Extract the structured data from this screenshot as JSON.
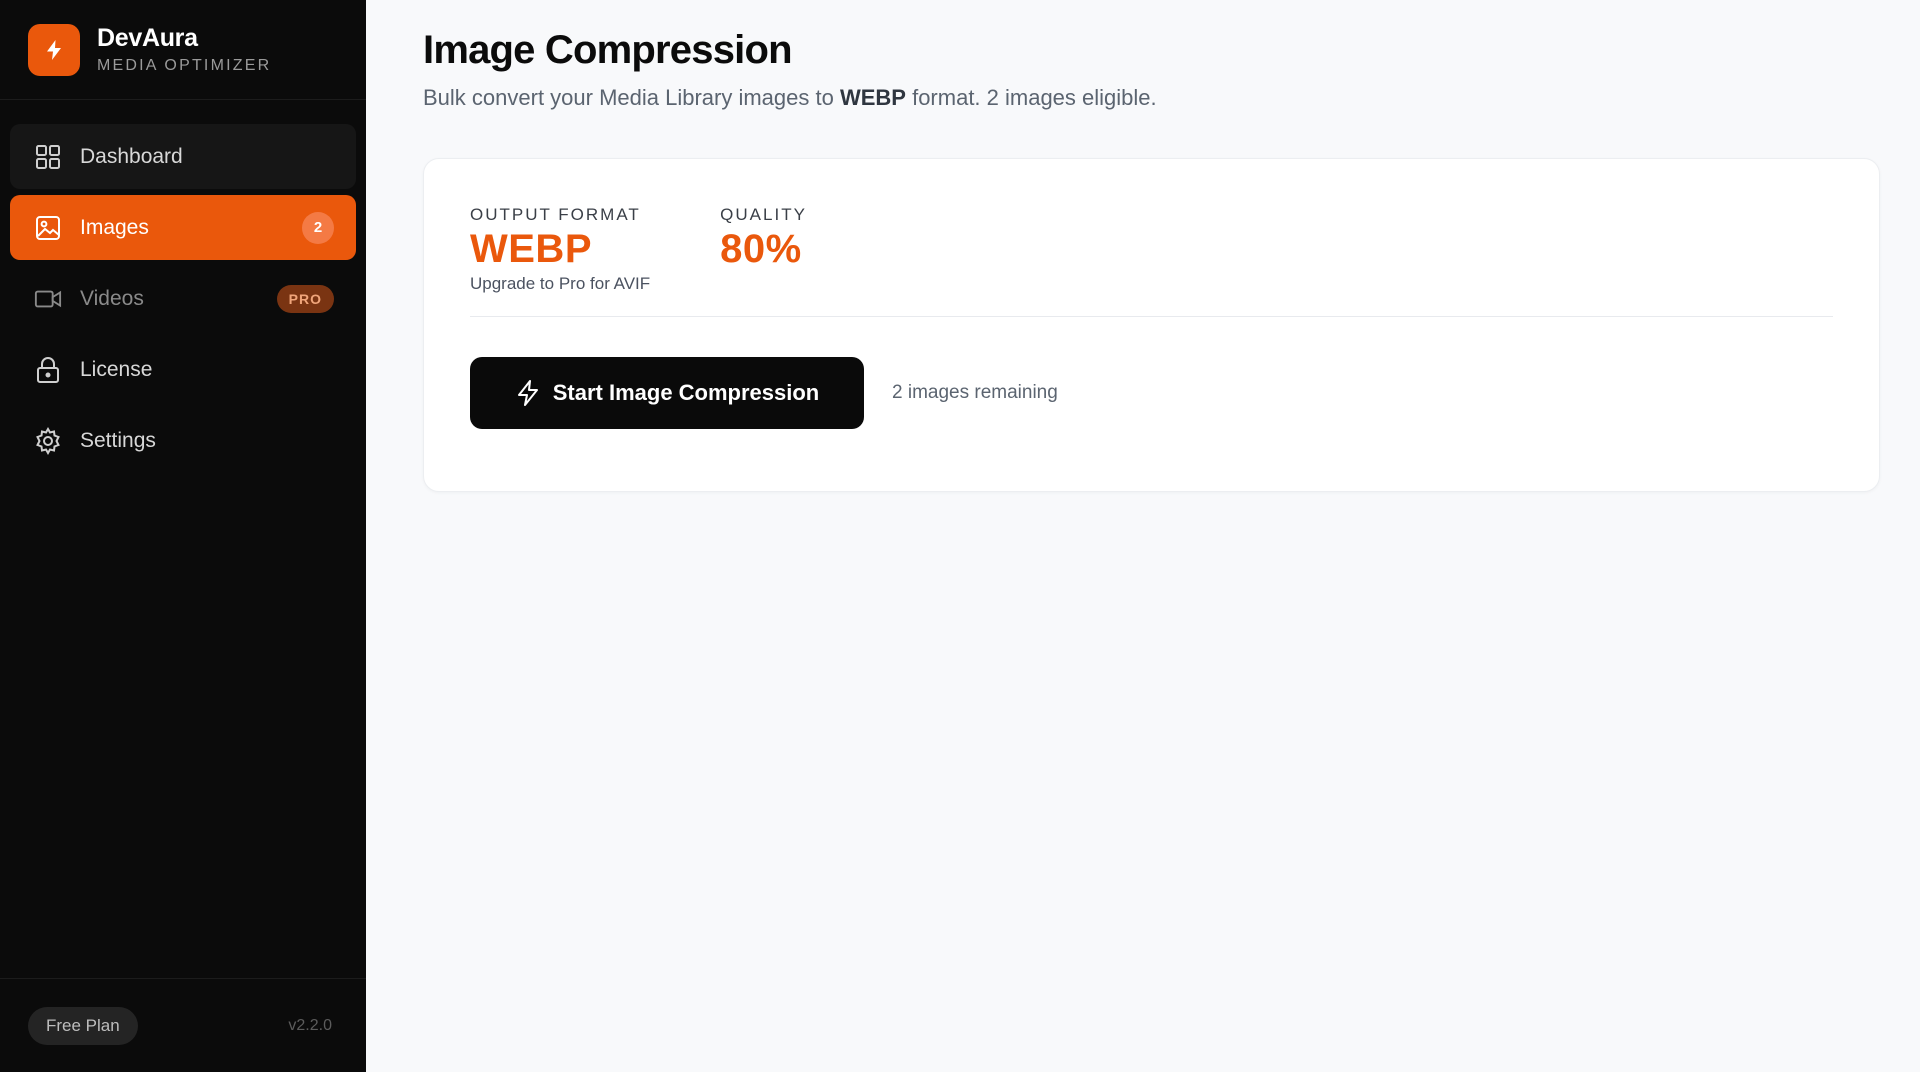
{
  "brand": {
    "name": "DevAura",
    "subtitle": "MEDIA OPTIMIZER",
    "logo_icon": "bolt-icon",
    "accent_color": "#ea580c"
  },
  "sidebar": {
    "items": [
      {
        "label": "Dashboard",
        "icon": "grid-icon",
        "state": "default"
      },
      {
        "label": "Images",
        "icon": "image-icon",
        "state": "active",
        "badge": "2"
      },
      {
        "label": "Videos",
        "icon": "video-icon",
        "state": "locked",
        "badge": "PRO"
      },
      {
        "label": "License",
        "icon": "lock-icon",
        "state": "default"
      },
      {
        "label": "Settings",
        "icon": "gear-icon",
        "state": "default"
      }
    ],
    "footer": {
      "plan": "Free Plan",
      "version": "v2.2.0"
    }
  },
  "main": {
    "title": "Image Compression",
    "subtitle": {
      "prefix": "Bulk convert your Media Library images to ",
      "format": "WEBP",
      "suffix": " format. 2 images eligible."
    },
    "card": {
      "output_format": {
        "label": "OUTPUT FORMAT",
        "value": "WEBP",
        "note": "Upgrade to Pro for AVIF"
      },
      "quality": {
        "label": "QUALITY",
        "value": "80%"
      },
      "start_button": {
        "label": "Start Image Compression",
        "icon": "bolt-icon"
      },
      "remaining": "2 images remaining"
    }
  }
}
